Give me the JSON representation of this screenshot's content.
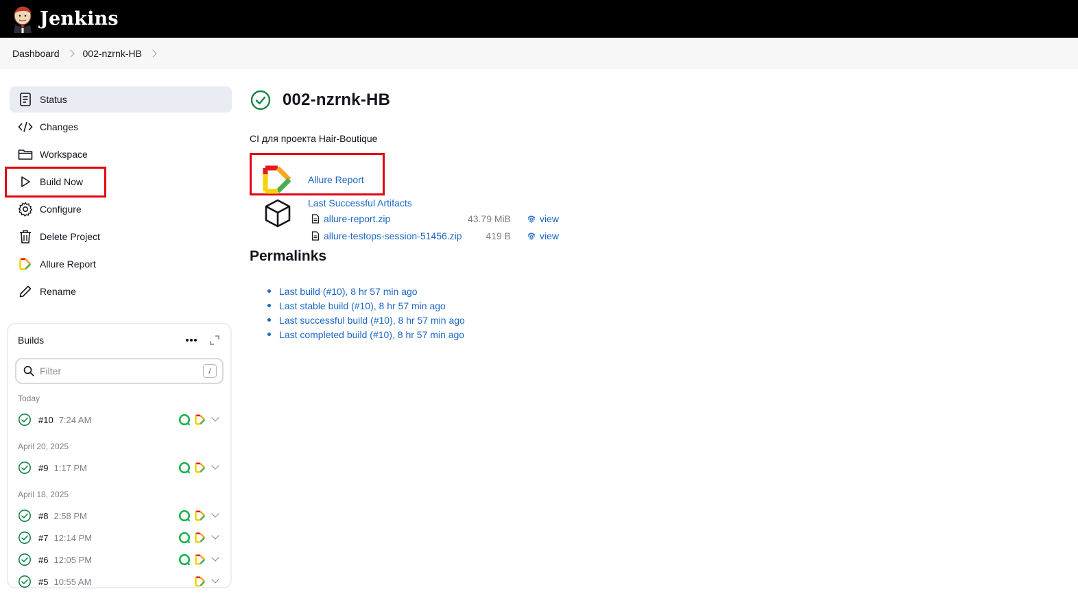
{
  "app": {
    "brand": "Jenkins"
  },
  "breadcrumb": [
    "Dashboard",
    "002-nzrnk-HB"
  ],
  "sidebar": {
    "items": [
      {
        "label": "Status",
        "icon": "document-icon",
        "active": true
      },
      {
        "label": "Changes",
        "icon": "code-icon"
      },
      {
        "label": "Workspace",
        "icon": "folder-icon"
      },
      {
        "label": "Build Now",
        "icon": "play-icon"
      },
      {
        "label": "Configure",
        "icon": "gear-icon"
      },
      {
        "label": "Delete Project",
        "icon": "trash-icon"
      },
      {
        "label": "Allure Report",
        "icon": "allure-icon"
      },
      {
        "label": "Rename",
        "icon": "pencil-icon"
      }
    ]
  },
  "builds": {
    "title": "Builds",
    "filter_placeholder": "Filter",
    "filter_shortcut": "/",
    "groups": [
      {
        "label": "Today",
        "rows": [
          {
            "num": "#10",
            "time": "7:24 AM",
            "testops": true
          }
        ]
      },
      {
        "label": "April 20, 2025",
        "rows": [
          {
            "num": "#9",
            "time": "1:17 PM",
            "testops": true
          }
        ]
      },
      {
        "label": "April 18, 2025",
        "rows": [
          {
            "num": "#8",
            "time": "2:58 PM",
            "testops": true
          },
          {
            "num": "#7",
            "time": "12:14 PM",
            "testops": true
          },
          {
            "num": "#6",
            "time": "12:05 PM",
            "testops": true
          },
          {
            "num": "#5",
            "time": "10:55 AM",
            "testops": false
          }
        ]
      }
    ]
  },
  "main": {
    "title": "002-nzrnk-HB",
    "description": "CI для проекта Hair-Boutique",
    "allure_link": "Allure Report",
    "artifacts_title": "Last Successful Artifacts",
    "artifacts": [
      {
        "name": "allure-report.zip",
        "size": "43.79 MiB",
        "view": "view"
      },
      {
        "name": "allure-testops-session-51456.zip",
        "size": "419 B",
        "view": "view"
      }
    ],
    "permalinks_title": "Permalinks",
    "permalinks": [
      "Last build (#10), 8 hr 57 min ago",
      "Last stable build (#10), 8 hr 57 min ago",
      "Last successful build (#10), 8 hr 57 min ago",
      "Last completed build (#10), 8 hr 57 min ago"
    ]
  },
  "colors": {
    "accent": "#1a66c4",
    "success": "#138347",
    "highlight": "#e3000f",
    "header": "#000000"
  }
}
